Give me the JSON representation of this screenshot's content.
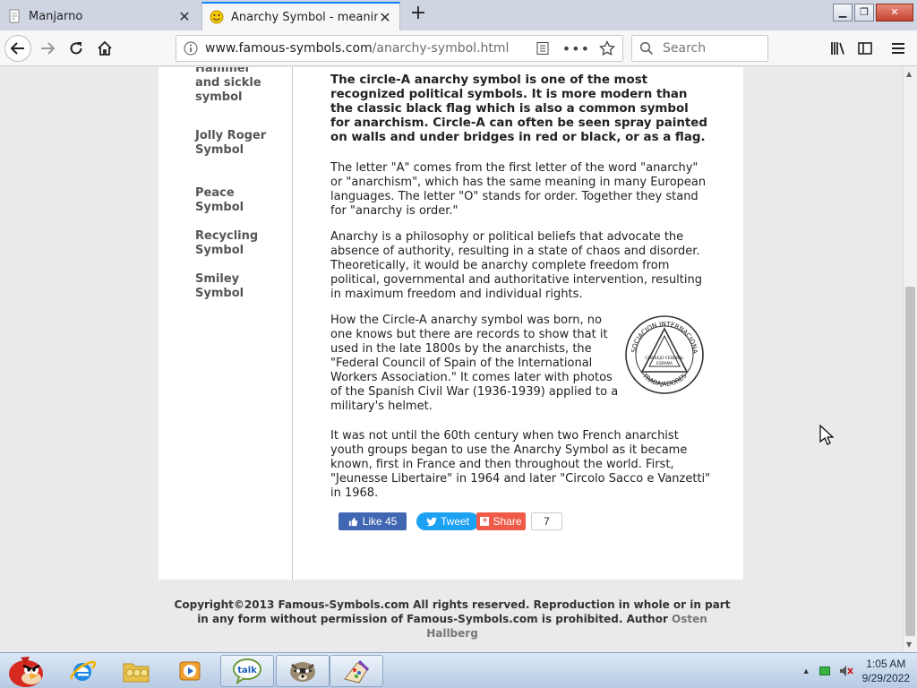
{
  "browser": {
    "tabs": [
      {
        "title": "Manjarno",
        "active": false
      },
      {
        "title": "Anarchy Symbol - meaning and history",
        "active": true
      }
    ],
    "url_domain": "www.famous-symbols.com",
    "url_path": "/anarchy-symbol.html",
    "search_placeholder": "Search"
  },
  "sidebar": {
    "links": [
      {
        "label": "Hammer and sickle symbol"
      },
      {
        "label": "Jolly Roger Symbol"
      },
      {
        "label": "Peace Symbol"
      },
      {
        "label": "Recycling Symbol"
      },
      {
        "label": "Smiley Symbol"
      }
    ]
  },
  "article": {
    "lead": "The circle-A anarchy symbol is one of the most recognized political symbols. It is more modern than the classic black flag which is also a common symbol for anarchism. Circle-A can often be seen spray painted on walls and under bridges in red or black, or as a flag.",
    "p1": "The letter \"A\" comes from the first letter of the word \"anarchy\" or \"anarchism\", which has the same meaning in many European languages. The letter \"O\" stands for order. Together they stand for \"anarchy is order.\"",
    "p2": "Anarchy is a philosophy or political beliefs that advocate the absence of authority, resulting in a state of chaos and disorder. Theoretically, it would be anarchy complete freedom from political, governmental and authoritative intervention, resulting in maximum freedom and individual rights.",
    "p3": "How the Circle-A anarchy symbol was born, no one knows but there are records to show that it used in the late 1800s by the anarchists, the \"Federal Council of Spain of the International Workers Association.\" It comes later with photos of the Spanish Civil War (1936-1939) applied to a military's helmet.",
    "p4": "It was not until the 60th century when two French anarchist youth groups began to use the Anarchy Symbol as it became known, first in France and then throughout the world. First, \"Jeunesse Libertaire\" in 1964 and later \"Circolo Sacco e Vanzetti\" in 1968.",
    "seal": {
      "ring_top": "ASOCIACION INTERNACIONAL",
      "ring_bottom": "TRABAJADORES",
      "inner": "CONSEJO FEDERAL",
      "center": "ESPAÑA"
    }
  },
  "social": {
    "like_label": "Like 45",
    "tweet_label": "Tweet",
    "share_label": "Share",
    "share_count": "7"
  },
  "footer": {
    "text": "Copyright©2013 Famous-Symbols.com All rights reserved. Reproduction in whole or in part in any form without permission of Famous-Symbols.com is prohibited. Author ",
    "author": "Osten Hallberg"
  },
  "taskbar": {
    "time": "1:05 AM",
    "date": "9/29/2022"
  }
}
